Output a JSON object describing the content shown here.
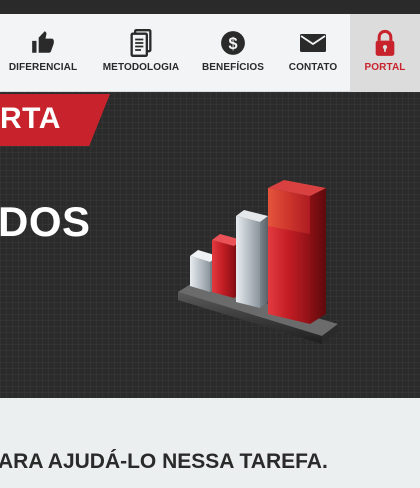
{
  "nav": {
    "items": [
      {
        "label": "DIFERENCIAL",
        "icon": "thumbs-up-icon"
      },
      {
        "label": "METODOLOGIA",
        "icon": "document-icon"
      },
      {
        "label": "BENEFÍCIOS",
        "icon": "dollar-icon"
      },
      {
        "label": "CONTATO",
        "icon": "envelope-icon"
      },
      {
        "label": "PORTAL",
        "icon": "lock-icon"
      }
    ],
    "active": "PORTAL"
  },
  "hero": {
    "tag": "RTA",
    "title": "DOS"
  },
  "bottom": {
    "text": "ARA AJUDÁ-LO NESSA TAREFA."
  },
  "colors": {
    "accent": "#c8232c",
    "dark": "#2c2b2b",
    "nav_bg": "#f2f4f5"
  }
}
